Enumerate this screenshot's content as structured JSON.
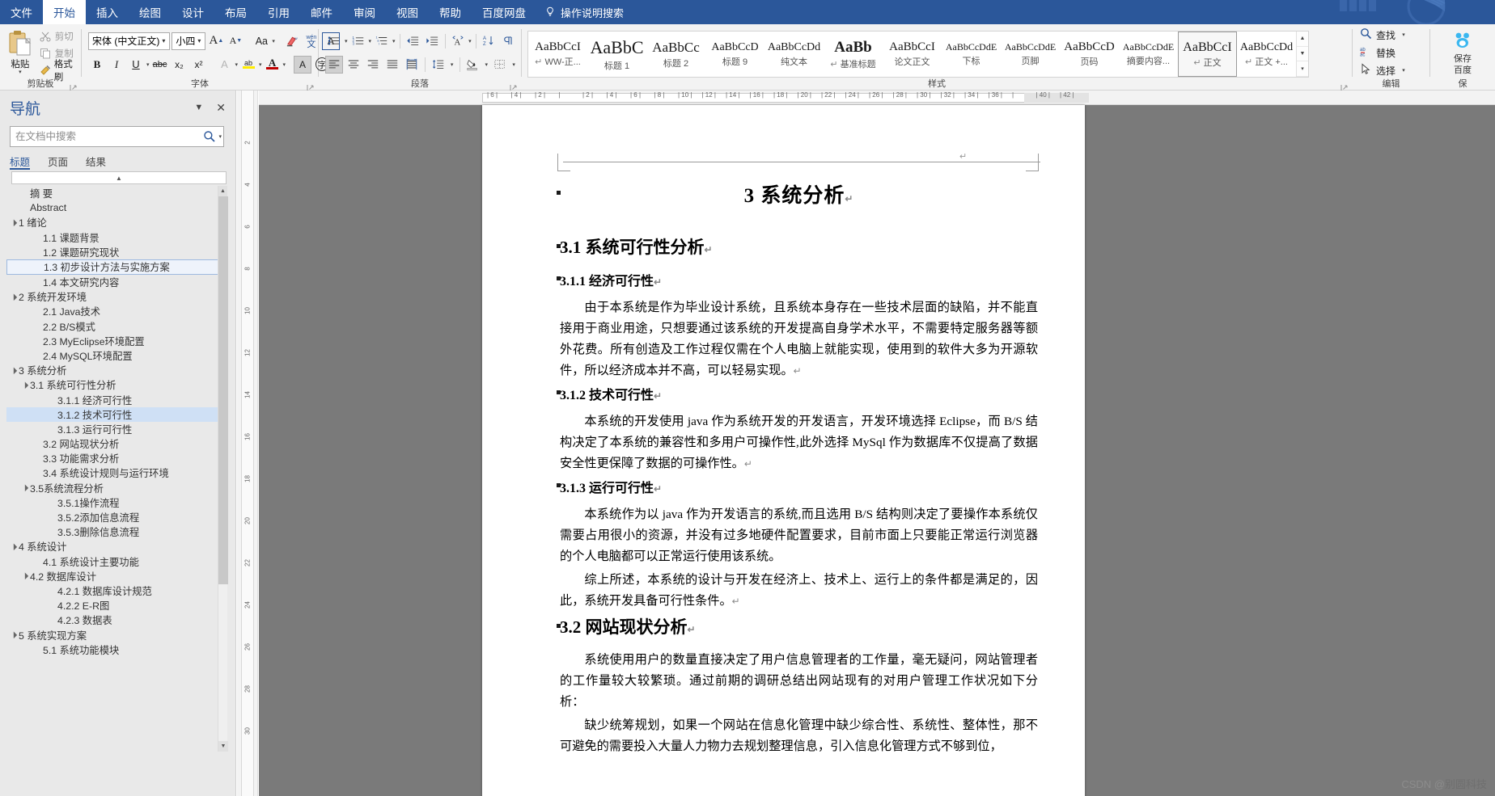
{
  "tabs": [
    {
      "label": "文件",
      "active": false
    },
    {
      "label": "开始",
      "active": true
    },
    {
      "label": "插入",
      "active": false
    },
    {
      "label": "绘图",
      "active": false
    },
    {
      "label": "设计",
      "active": false
    },
    {
      "label": "布局",
      "active": false
    },
    {
      "label": "引用",
      "active": false
    },
    {
      "label": "邮件",
      "active": false
    },
    {
      "label": "审阅",
      "active": false
    },
    {
      "label": "视图",
      "active": false
    },
    {
      "label": "帮助",
      "active": false
    },
    {
      "label": "百度网盘",
      "active": false
    }
  ],
  "tellme": "操作说明搜索",
  "ribbon": {
    "clipboard": {
      "group_label": "剪贴板",
      "paste": "粘贴",
      "cut": "剪切",
      "copy": "复制",
      "format_painter": "格式刷"
    },
    "font": {
      "group_label": "字体",
      "font_name": "宋体 (中文正文)",
      "font_size": "小四",
      "grow_font": "A",
      "shrink_font": "A",
      "change_case": "Aa",
      "clear_format": "clear-formatting-icon",
      "phonetic": "wén",
      "char_border": "A",
      "bold": "B",
      "italic": "I",
      "underline": "U",
      "strikethrough": "abc",
      "subscript": "x₂",
      "superscript": "x²",
      "text_effects": "A",
      "highlight": "ab",
      "font_color": "A",
      "shading": "A",
      "enclose_char": "字"
    },
    "paragraph": {
      "group_label": "段落",
      "bullets": "bullet-list-icon",
      "numbering": "numbered-list-icon",
      "multilevel": "multilevel-list-icon",
      "decrease_indent": "decrease-indent-icon",
      "increase_indent": "increase-indent-icon",
      "asian_layout": "asian-layout-icon",
      "sort": "sort-icon",
      "show_marks": "show-paragraph-marks-icon",
      "align_left": "align-left-icon",
      "align_center": "align-center-icon",
      "align_right": "align-right-icon",
      "justify": "justify-icon",
      "distribute": "distribute-icon",
      "line_spacing": "line-spacing-icon",
      "shading_fill": "shading-icon",
      "borders": "borders-icon"
    },
    "styles": {
      "group_label": "样式",
      "items": [
        {
          "preview": "AaBbCcI",
          "name": "WW-正...",
          "pilcrow": true,
          "size": 15,
          "bold": false,
          "selected": false
        },
        {
          "preview": "AaBbC",
          "name": "标题 1",
          "pilcrow": false,
          "size": 22,
          "bold": false,
          "selected": false
        },
        {
          "preview": "AaBbCc",
          "name": "标题 2",
          "pilcrow": false,
          "size": 17,
          "bold": false,
          "selected": false
        },
        {
          "preview": "AaBbCcD",
          "name": "标题 9",
          "pilcrow": false,
          "size": 14,
          "bold": false,
          "selected": false
        },
        {
          "preview": "AaBbCcDd",
          "name": "纯文本",
          "pilcrow": false,
          "size": 14,
          "bold": false,
          "selected": false
        },
        {
          "preview": "AaBb",
          "name": "基准标题",
          "pilcrow": true,
          "size": 19,
          "bold": true,
          "selected": false
        },
        {
          "preview": "AaBbCcI",
          "name": "论文正文",
          "pilcrow": false,
          "size": 15,
          "bold": false,
          "selected": false
        },
        {
          "preview": "AaBbCcDdE",
          "name": "下标",
          "pilcrow": false,
          "size": 12,
          "bold": false,
          "selected": false
        },
        {
          "preview": "AaBbCcDdE",
          "name": "页脚",
          "pilcrow": false,
          "size": 12,
          "bold": false,
          "selected": false
        },
        {
          "preview": "AaBbCcD",
          "name": "页码",
          "pilcrow": false,
          "size": 15,
          "bold": false,
          "selected": false
        },
        {
          "preview": "AaBbCcDdE",
          "name": "摘要内容...",
          "pilcrow": false,
          "size": 12,
          "bold": false,
          "selected": false
        },
        {
          "preview": "AaBbCcI",
          "name": "正文",
          "pilcrow": true,
          "size": 16,
          "bold": false,
          "selected": true
        },
        {
          "preview": "AaBbCcDd",
          "name": "正文 +...",
          "pilcrow": true,
          "size": 14,
          "bold": false,
          "selected": false
        }
      ]
    },
    "editing": {
      "group_label": "编辑",
      "find": "查找",
      "replace": "替换",
      "select": "选择"
    },
    "baidu": {
      "line1": "保存",
      "line2": "百度",
      "line3": "保"
    }
  },
  "navigation": {
    "title": "导航",
    "search_placeholder": "在文档中搜索",
    "search_value": "",
    "tabs": [
      {
        "label": "标题",
        "active": true
      },
      {
        "label": "页面",
        "active": false
      },
      {
        "label": "结果",
        "active": false
      }
    ],
    "items": [
      {
        "label": "摘 要",
        "level": 1,
        "tri": "",
        "state": "none"
      },
      {
        "label": "Abstract",
        "level": 1,
        "tri": "",
        "state": "none"
      },
      {
        "label": "1 绪论",
        "level": 0,
        "tri": "▲",
        "state": "none"
      },
      {
        "label": "1.1 课题背景",
        "level": 2,
        "tri": "",
        "state": "none"
      },
      {
        "label": "1.2 课题研究现状",
        "level": 2,
        "tri": "",
        "state": "none"
      },
      {
        "label": "1.3 初步设计方法与实施方案",
        "level": 2,
        "tri": "",
        "state": "box"
      },
      {
        "label": "1.4 本文研究内容",
        "level": 2,
        "tri": "",
        "state": "none"
      },
      {
        "label": "2 系统开发环境",
        "level": 0,
        "tri": "▲",
        "state": "none"
      },
      {
        "label": "2.1 Java技术",
        "level": 2,
        "tri": "",
        "state": "none"
      },
      {
        "label": "2.2 B/S模式",
        "level": 2,
        "tri": "",
        "state": "none"
      },
      {
        "label": "2.3 MyEclipse环境配置",
        "level": 2,
        "tri": "",
        "state": "none"
      },
      {
        "label": "2.4 MySQL环境配置",
        "level": 2,
        "tri": "",
        "state": "none"
      },
      {
        "label": "3 系统分析",
        "level": 0,
        "tri": "▲",
        "state": "none"
      },
      {
        "label": "3.1 系统可行性分析",
        "level": 1,
        "tri": "▲",
        "state": "none"
      },
      {
        "label": "3.1.1 经济可行性",
        "level": 3,
        "tri": "",
        "state": "none"
      },
      {
        "label": "3.1.2 技术可行性",
        "level": 3,
        "tri": "",
        "state": "sel"
      },
      {
        "label": "3.1.3 运行可行性",
        "level": 3,
        "tri": "",
        "state": "none"
      },
      {
        "label": "3.2 网站现状分析",
        "level": 2,
        "tri": "",
        "state": "none"
      },
      {
        "label": "3.3 功能需求分析",
        "level": 2,
        "tri": "",
        "state": "none"
      },
      {
        "label": "3.4 系统设计规则与运行环境",
        "level": 2,
        "tri": "",
        "state": "none"
      },
      {
        "label": "3.5系统流程分析",
        "level": 1,
        "tri": "▲",
        "state": "none"
      },
      {
        "label": "3.5.1操作流程",
        "level": 3,
        "tri": "",
        "state": "none"
      },
      {
        "label": "3.5.2添加信息流程",
        "level": 3,
        "tri": "",
        "state": "none"
      },
      {
        "label": "3.5.3删除信息流程",
        "level": 3,
        "tri": "",
        "state": "none"
      },
      {
        "label": "4 系统设计",
        "level": 0,
        "tri": "▲",
        "state": "none"
      },
      {
        "label": "4.1 系统设计主要功能",
        "level": 2,
        "tri": "",
        "state": "none"
      },
      {
        "label": "4.2 数据库设计",
        "level": 1,
        "tri": "▲",
        "state": "none"
      },
      {
        "label": "4.2.1 数据库设计规范",
        "level": 3,
        "tri": "",
        "state": "none"
      },
      {
        "label": "4.2.2 E-R图",
        "level": 3,
        "tri": "",
        "state": "none"
      },
      {
        "label": "4.2.3 数据表",
        "level": 3,
        "tri": "",
        "state": "none"
      },
      {
        "label": "5 系统实现方案",
        "level": 0,
        "tri": "▲",
        "state": "none"
      },
      {
        "label": "5.1  系统功能模块",
        "level": 2,
        "tri": "",
        "state": "none"
      }
    ]
  },
  "ruler": {
    "horizontal": [
      "6",
      "4",
      "2",
      "",
      "2",
      "4",
      "6",
      "8",
      "10",
      "12",
      "14",
      "16",
      "18",
      "20",
      "22",
      "24",
      "26",
      "28",
      "30",
      "32",
      "34",
      "36",
      "",
      "40",
      "42"
    ],
    "vertical": [
      "2",
      "4",
      "6",
      "8",
      "10",
      "12",
      "14",
      "16",
      "18",
      "20",
      "22",
      "24",
      "26",
      "28",
      "30"
    ]
  },
  "document": {
    "header_pilcrow": "↵",
    "title": "3  系统分析",
    "blocks": [
      {
        "type": "h2",
        "text": "3.1  系统可行性分析",
        "bullet": true
      },
      {
        "type": "h3",
        "text": "3.1.1  经济可行性",
        "bullet": true
      },
      {
        "type": "p",
        "text": "由于本系统是作为毕业设计系统，且系统本身存在一些技术层面的缺陷，并不能直接用于商业用途，只想要通过该系统的开发提高自身学术水平，不需要特定服务器等额外花费。所有创造及工作过程仅需在个人电脑上就能实现，使用到的软件大多为开源软件，所以经济成本并不高，可以轻易实现。"
      },
      {
        "type": "h3",
        "text": "3.1.2  技术可行性",
        "bullet": true
      },
      {
        "type": "p",
        "text": "本系统的开发使用 java 作为系统开发的开发语言，开发环境选择 Eclipse，而 B/S 结构决定了本系统的兼容性和多用户可操作性,此外选择 MySql 作为数据库不仅提高了数据安全性更保障了数据的可操作性。"
      },
      {
        "type": "h3",
        "text": "3.1.3  运行可行性",
        "bullet": true
      },
      {
        "type": "p",
        "text": "本系统作为以 java 作为开发语言的系统,而且选用 B/S 结构则决定了要操作本系统仅需要占用很小的资源，并没有过多地硬件配置要求，目前市面上只要能正常运行浏览器的个人电脑都可以正常运行使用该系统。"
      },
      {
        "type": "p",
        "text": "综上所述，本系统的设计与开发在经济上、技术上、运行上的条件都是满足的，因此，系统开发具备可行性条件。"
      },
      {
        "type": "h2",
        "text": "3.2  网站现状分析",
        "bullet": true
      },
      {
        "type": "p",
        "text": "系统使用用户的数量直接决定了用户信息管理者的工作量，毫无疑问，网站管理者的工作量较大较繁琐。通过前期的调研总结出网站现有的对用户管理工作状况如下分析："
      },
      {
        "type": "p",
        "text": "缺少统筹规划，如果一个网站在信息化管理中缺少综合性、系统性、整体性，那不可避免的需要投入大量人力物力去规划整理信息，引入信息化管理方式不够到位，"
      }
    ],
    "pilcrow": "↵"
  },
  "watermark": {
    "prefix": "CSDN @",
    "author": "别圆科技"
  },
  "colors": {
    "ribbon_blue": "#2b579a",
    "selection_blue": "#cfe0f5",
    "accent_red": "#c00000"
  }
}
